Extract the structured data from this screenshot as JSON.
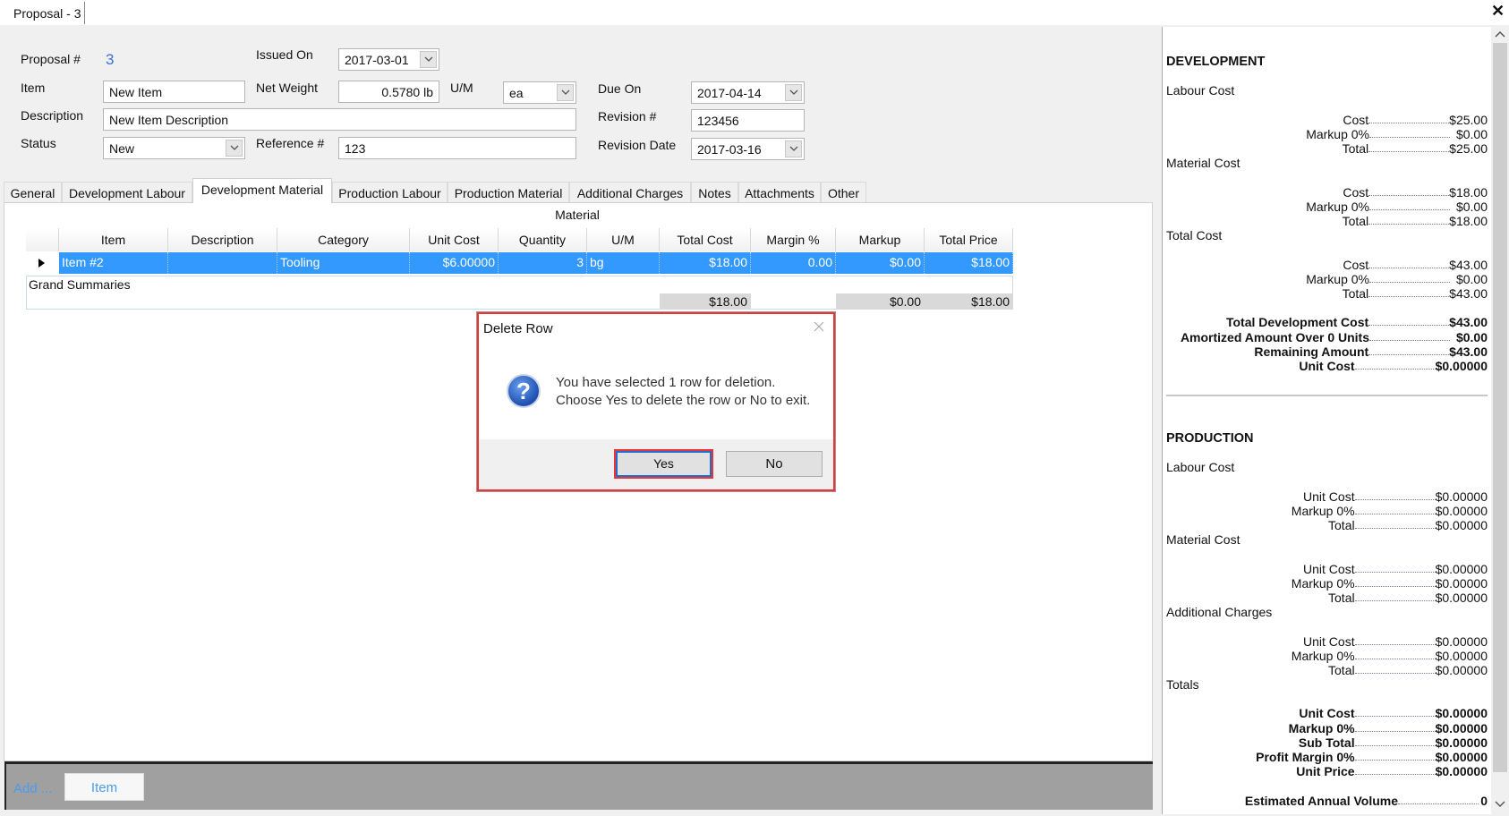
{
  "window": {
    "tab_title": "Proposal - 3",
    "close": "✕"
  },
  "form": {
    "proposal_label": "Proposal #",
    "proposal_value": "3",
    "issued_label": "Issued On",
    "issued_value": "2017-03-01",
    "item_label": "Item",
    "item_value": "New Item",
    "netweight_label": "Net Weight",
    "netweight_value": "0.5780 lb",
    "um_label": "U/M",
    "um_value": "ea",
    "due_label": "Due On",
    "due_value": "2017-04-14",
    "description_label": "Description",
    "description_value": "New Item Description",
    "revision_label": "Revision #",
    "revision_value": "123456",
    "status_label": "Status",
    "status_value": "New",
    "reference_label": "Reference #",
    "reference_value": "123",
    "revdate_label": "Revision Date",
    "revdate_value": "2017-03-16"
  },
  "tabs": [
    "General",
    "Development Labour",
    "Development Material",
    "Production Labour",
    "Production Material",
    "Additional Charges",
    "Notes",
    "Attachments",
    "Other"
  ],
  "active_tab": "Development Material",
  "grid": {
    "caption": "Material",
    "columns": [
      "Item",
      "Description",
      "Category",
      "Unit Cost",
      "Quantity",
      "U/M",
      "Total Cost",
      "Margin %",
      "Markup",
      "Total Price"
    ],
    "rows": [
      [
        "Item #2",
        "",
        "Tooling",
        "$6.00000",
        "3",
        "bg",
        "$18.00",
        "0.00",
        "$0.00",
        "$18.00"
      ]
    ],
    "summary_label": "Grand Summaries",
    "summary": {
      "total_cost": "$18.00",
      "markup": "$0.00",
      "total_price": "$18.00"
    },
    "selection_color": "#3399ff"
  },
  "bottom": {
    "add_label": "Add ...",
    "item_button": "Item"
  },
  "dialog": {
    "title": "Delete Row",
    "line1": "You have selected 1 row for deletion.",
    "line2": "Choose Yes to delete the row or No to exit.",
    "yes": "Yes",
    "no": "No",
    "icon": "question-icon"
  },
  "summary_panel": {
    "development": {
      "heading": "DEVELOPMENT",
      "groups": [
        {
          "title": "Labour Cost",
          "lines": [
            {
              "label": "Cost",
              "value": "$25.00"
            },
            {
              "label": "Markup 0%",
              "value": "$0.00"
            },
            {
              "label": "Total",
              "value": "$25.00"
            }
          ]
        },
        {
          "title": "Material Cost",
          "lines": [
            {
              "label": "Cost",
              "value": "$18.00"
            },
            {
              "label": "Markup 0%",
              "value": "$0.00"
            },
            {
              "label": "Total",
              "value": "$18.00"
            }
          ]
        },
        {
          "title": "Total Cost",
          "lines": [
            {
              "label": "Cost",
              "value": "$43.00"
            },
            {
              "label": "Markup 0%",
              "value": "$0.00"
            },
            {
              "label": "Total",
              "value": "$43.00"
            }
          ]
        }
      ],
      "summary": [
        {
          "label": "Total Development Cost",
          "value": "$43.00"
        },
        {
          "label": "Amortized Amount Over 0 Units",
          "value": "$0.00"
        },
        {
          "label": "Remaining Amount",
          "value": "$43.00"
        },
        {
          "label": "Unit Cost",
          "value": "$0.00000"
        }
      ]
    },
    "production": {
      "heading": "PRODUCTION",
      "groups": [
        {
          "title": "Labour Cost",
          "lines": [
            {
              "label": "Unit Cost",
              "value": "$0.00000"
            },
            {
              "label": "Markup 0%",
              "value": "$0.00000"
            },
            {
              "label": "Total",
              "value": "$0.00000"
            }
          ]
        },
        {
          "title": "Material Cost",
          "lines": [
            {
              "label": "Unit Cost",
              "value": "$0.00000"
            },
            {
              "label": "Markup 0%",
              "value": "$0.00000"
            },
            {
              "label": "Total",
              "value": "$0.00000"
            }
          ]
        },
        {
          "title": "Additional Charges",
          "lines": [
            {
              "label": "Unit Cost",
              "value": "$0.00000"
            },
            {
              "label": "Markup 0%",
              "value": "$0.00000"
            },
            {
              "label": "Total",
              "value": "$0.00000"
            }
          ]
        },
        {
          "title": "Totals",
          "bold": true,
          "lines": [
            {
              "label": "Unit Cost",
              "value": "$0.00000"
            },
            {
              "label": "Markup 0%",
              "value": "$0.00000"
            },
            {
              "label": "Sub Total",
              "value": "$0.00000"
            },
            {
              "label": "Profit Margin 0%",
              "value": "$0.00000"
            },
            {
              "label": "Unit Price",
              "value": "$0.00000"
            }
          ]
        }
      ],
      "footer": {
        "label": "Estimated Annual Volume",
        "value": "0"
      }
    }
  }
}
